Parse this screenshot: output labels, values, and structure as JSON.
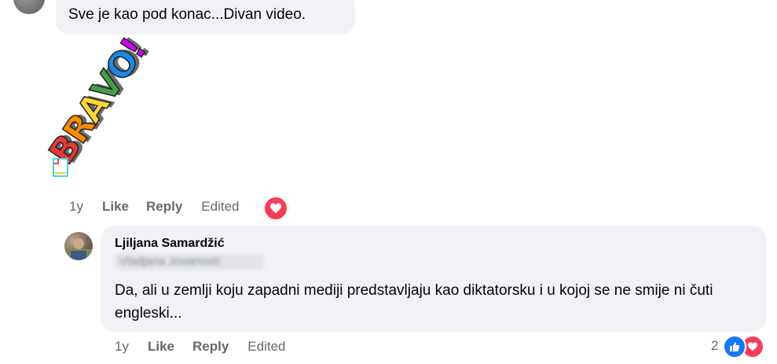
{
  "comment1": {
    "text": "Sve je kao pod konac...Divan video.",
    "sticker_text": "BRAVO!",
    "time": "1y",
    "like_label": "Like",
    "reply_label": "Reply",
    "edited_label": "Edited",
    "reaction_icon": "love-reaction"
  },
  "comment2": {
    "author": "Ljiljana Samardžić",
    "tagged_name": "Vladjana Jovanović",
    "text": "Da, ali u zemlji koju zapadni mediji predstavljaju kao diktatorsku i u kojoj se ne smije ni čuti engleski...",
    "time": "1y",
    "like_label": "Like",
    "reply_label": "Reply",
    "edited_label": "Edited",
    "reaction_count": "2",
    "reaction_icons": [
      "like-reaction",
      "love-reaction"
    ]
  },
  "colors": {
    "bubble": "#f0f2f5",
    "meta_text": "#65676b",
    "like_blue": "#1877f2",
    "love_red": "#f33e58"
  }
}
